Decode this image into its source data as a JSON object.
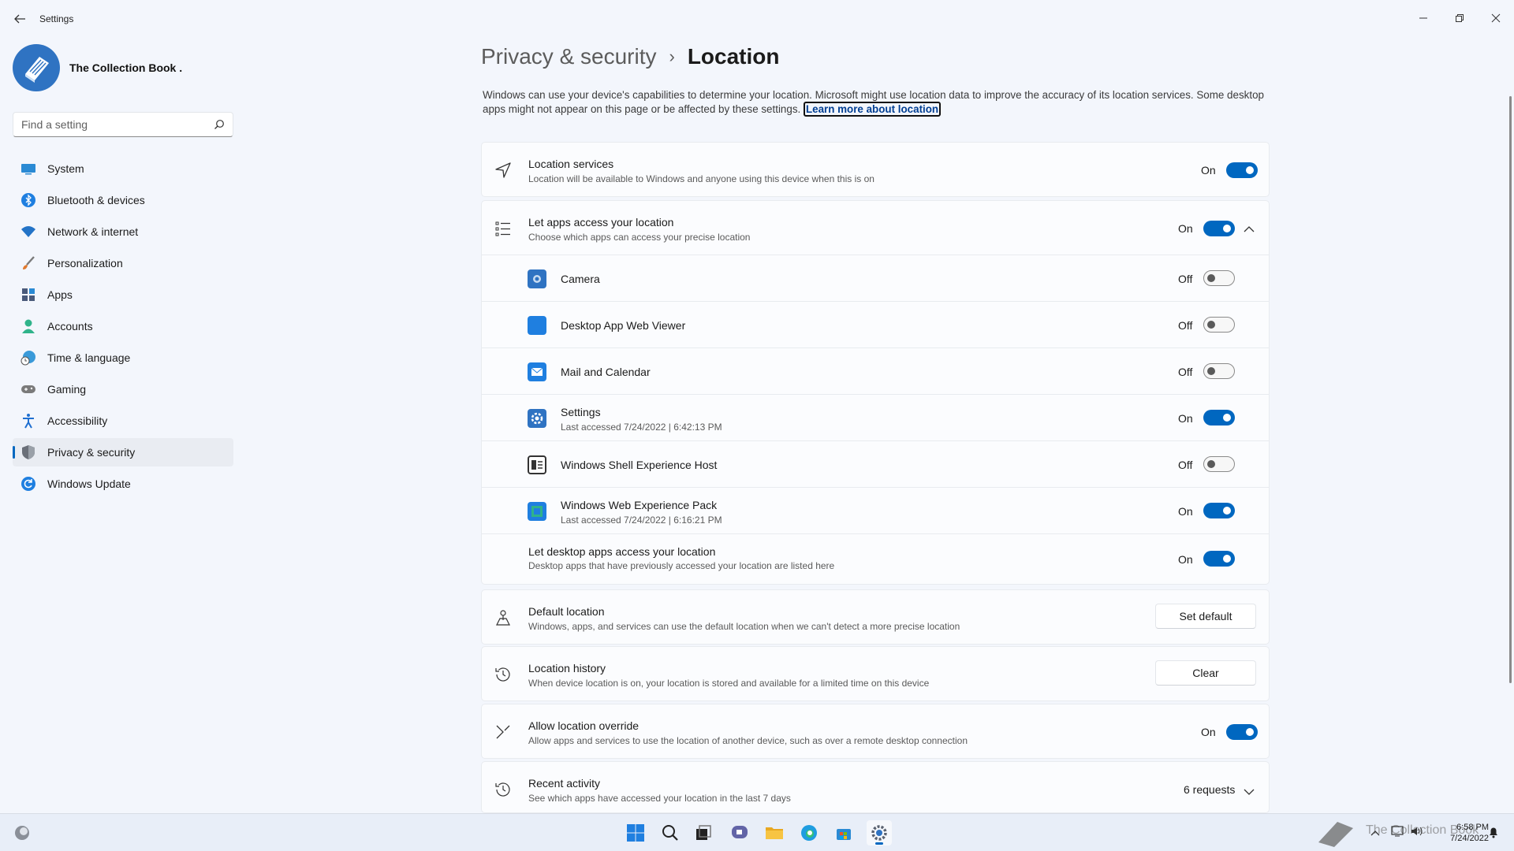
{
  "window": {
    "title": "Settings",
    "back_icon": "arrow-left-icon",
    "controls": [
      "minimize-icon",
      "restore-icon",
      "close-icon"
    ]
  },
  "profile": {
    "name": "The Collection Book ."
  },
  "search": {
    "placeholder": "Find a setting"
  },
  "sidebar": {
    "items": [
      {
        "label": "System",
        "icon": "monitor-icon",
        "color": "#2a8ad4"
      },
      {
        "label": "Bluetooth & devices",
        "icon": "bluetooth-icon",
        "color": "#1f7fe0"
      },
      {
        "label": "Network & internet",
        "icon": "wifi-icon",
        "color": "#2373c7"
      },
      {
        "label": "Personalization",
        "icon": "brush-icon",
        "color": "#e07a30"
      },
      {
        "label": "Apps",
        "icon": "apps-icon",
        "color": "#4a5a7a"
      },
      {
        "label": "Accounts",
        "icon": "person-icon",
        "color": "#2fb38a"
      },
      {
        "label": "Time & language",
        "icon": "globe-clock-icon",
        "color": "#3a9ad9"
      },
      {
        "label": "Gaming",
        "icon": "gamepad-icon",
        "color": "#7a7a7a"
      },
      {
        "label": "Accessibility",
        "icon": "accessibility-icon",
        "color": "#1f6fd0"
      },
      {
        "label": "Privacy & security",
        "icon": "shield-icon",
        "color": "#6a6f78"
      },
      {
        "label": "Windows Update",
        "icon": "update-icon",
        "color": "#1f7fe0"
      }
    ],
    "active_index": 9
  },
  "breadcrumb": {
    "parent": "Privacy & security",
    "separator": "›",
    "current": "Location"
  },
  "description": {
    "text": "Windows can use your device's capabilities to determine your location. Microsoft might use location data to improve the accuracy of its location services. Some desktop apps might not appear on this page or be affected by these settings. ",
    "link": "Learn more about location"
  },
  "location_services": {
    "title": "Location services",
    "subtitle": "Location will be available to Windows and anyone using this device when this is on",
    "state": "On",
    "icon": "navigation-arrow-icon"
  },
  "apps_access": {
    "title": "Let apps access your location",
    "subtitle": "Choose which apps can access your precise location",
    "state": "On",
    "icon": "list-icon",
    "expand_icon": "chevron-up-icon",
    "apps": [
      {
        "name": "Camera",
        "sub": "",
        "state": "Off",
        "icon": "camera-app-icon"
      },
      {
        "name": "Desktop App Web Viewer",
        "sub": "",
        "state": "Off",
        "icon": "web-viewer-app-icon"
      },
      {
        "name": "Mail and Calendar",
        "sub": "",
        "state": "Off",
        "icon": "mail-app-icon"
      },
      {
        "name": "Settings",
        "sub": "Last accessed 7/24/2022  |  6:42:13 PM",
        "state": "On",
        "icon": "settings-app-icon"
      },
      {
        "name": "Windows Shell Experience Host",
        "sub": "",
        "state": "Off",
        "icon": "shell-host-app-icon"
      },
      {
        "name": "Windows Web Experience Pack",
        "sub": "Last accessed 7/24/2022  |  6:16:21 PM",
        "state": "On",
        "icon": "web-experience-app-icon"
      }
    ],
    "desktop": {
      "title": "Let desktop apps access your location",
      "subtitle": "Desktop apps that have previously accessed your location are listed here",
      "state": "On"
    }
  },
  "default_location": {
    "title": "Default location",
    "subtitle": "Windows, apps, and services can use the default location when we can't detect a more precise location",
    "button": "Set default",
    "icon": "person-pin-icon"
  },
  "location_history": {
    "title": "Location history",
    "subtitle": "When device location is on, your location is stored and available for a limited time on this device",
    "button": "Clear",
    "icon": "history-icon"
  },
  "location_override": {
    "title": "Allow location override",
    "subtitle": "Allow apps and services to use the location of another device, such as over a remote desktop connection",
    "state": "On",
    "icon": "override-icon"
  },
  "recent_activity": {
    "title": "Recent activity",
    "subtitle": "See which apps have accessed your location in the last 7 days",
    "count": "6 requests",
    "icon": "history-icon",
    "expand_icon": "chevron-down-icon"
  },
  "taskbar": {
    "apps": [
      "start-icon",
      "search-icon",
      "task-view-icon",
      "chat-icon",
      "file-explorer-icon",
      "edge-icon",
      "store-icon",
      "settings-icon"
    ],
    "time": "6:58 PM",
    "date": "7/24/2022",
    "watermark": "The Collection Book"
  },
  "colors": {
    "accent": "#0067c0",
    "background": "#f3f6fc",
    "card": "#fbfcfe"
  }
}
